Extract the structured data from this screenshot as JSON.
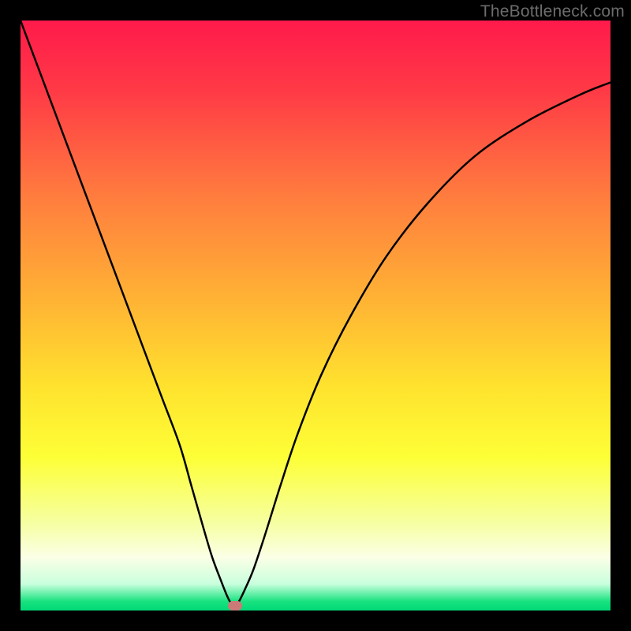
{
  "attribution": "TheBottleneck.com",
  "chart_data": {
    "type": "line",
    "title": "",
    "xlabel": "",
    "ylabel": "",
    "xlim": [
      0,
      100
    ],
    "ylim": [
      0,
      100
    ],
    "background_gradient": {
      "stops": [
        {
          "pos": 0.0,
          "color": "#ff1a4b"
        },
        {
          "pos": 0.12,
          "color": "#ff3a46"
        },
        {
          "pos": 0.3,
          "color": "#ff7d3e"
        },
        {
          "pos": 0.48,
          "color": "#ffb534"
        },
        {
          "pos": 0.62,
          "color": "#ffe22e"
        },
        {
          "pos": 0.74,
          "color": "#fdff36"
        },
        {
          "pos": 0.85,
          "color": "#f6ffa0"
        },
        {
          "pos": 0.91,
          "color": "#fbffe6"
        },
        {
          "pos": 0.955,
          "color": "#c9ffdd"
        },
        {
          "pos": 0.985,
          "color": "#17e27f"
        },
        {
          "pos": 1.0,
          "color": "#00d977"
        }
      ]
    },
    "series": [
      {
        "name": "bottleneck-curve",
        "stroke": "#000000",
        "stroke_width": 2.5,
        "x": [
          0,
          3,
          6,
          9,
          12,
          15,
          18,
          21,
          24,
          27,
          29,
          31,
          32.5,
          34,
          35,
          35.7,
          36.3,
          37,
          38,
          39.5,
          41.5,
          44,
          47,
          51,
          56,
          62,
          69,
          77,
          86,
          95,
          100
        ],
        "values": [
          100,
          92,
          84,
          76,
          68,
          60,
          52,
          44,
          36,
          28,
          21,
          14,
          9,
          5,
          2.5,
          1.2,
          1.0,
          1.5,
          3.5,
          7,
          13,
          21,
          30,
          40,
          50,
          60,
          69,
          77,
          83,
          87.5,
          89.5
        ]
      }
    ],
    "marker": {
      "x": 36.3,
      "y": 0.8,
      "color": "#cb7a78"
    }
  }
}
